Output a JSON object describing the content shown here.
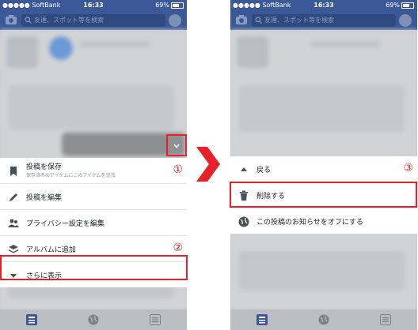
{
  "left_phone": {
    "status": {
      "carrier": "●●●●● SoftBank",
      "time": "16:33",
      "battery": "69%"
    },
    "search": {
      "placeholder": "友達、スポット等を検索"
    },
    "menu": [
      {
        "label": "投稿を保存",
        "sublabel": "保存済みのアイテムにこのアイテムを追加",
        "icon": "bookmark-icon"
      },
      {
        "label": "投稿を編集",
        "icon": "pencil-icon"
      },
      {
        "label": "プライバシー設定を編集",
        "icon": "people-icon"
      },
      {
        "label": "アルバムに追加",
        "icon": "layers-icon"
      },
      {
        "label": "さらに表示",
        "icon": "caret-down-icon"
      }
    ],
    "annotations": {
      "step1": "①",
      "step2": "②"
    }
  },
  "right_phone": {
    "status": {
      "carrier": "●●●●● SoftBank",
      "time": "16:33",
      "battery": "69%"
    },
    "search": {
      "placeholder": "友達、スポット等を検索"
    },
    "menu": [
      {
        "label": "戻る",
        "icon": "caret-up-icon"
      },
      {
        "label": "削除する",
        "icon": "trash-icon"
      },
      {
        "label": "この投稿のお知らせをオフにする",
        "icon": "globe-icon"
      }
    ],
    "annotations": {
      "step3": "③"
    }
  },
  "colors": {
    "facebook_blue": "#3b5998",
    "highlight_red": "#e8202a"
  }
}
